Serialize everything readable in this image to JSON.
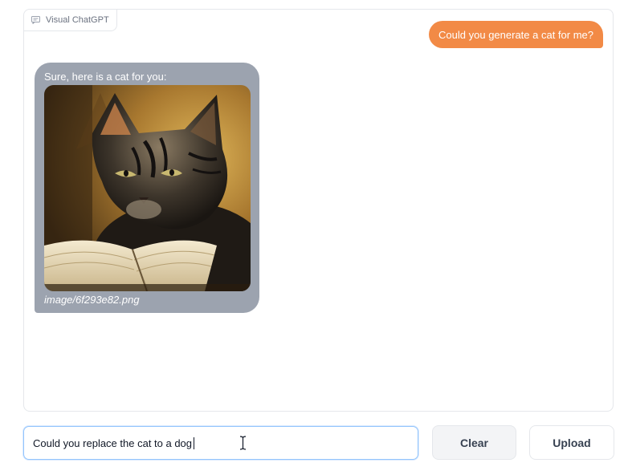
{
  "chatbot": {
    "label": "Visual ChatGPT",
    "label_icon": "chat-icon",
    "messages": [
      {
        "role": "user",
        "text": "Could you generate a cat for me?"
      },
      {
        "role": "bot",
        "text": "Sure, here is a cat for you:",
        "image_caption": "image/6f293e82.png"
      }
    ]
  },
  "input": {
    "value": "Could you replace the cat to a dog"
  },
  "buttons": {
    "clear_label": "Clear",
    "upload_label": "Upload"
  },
  "colors": {
    "user_bubble": "#f28a46",
    "bot_bubble": "#9ca3af",
    "input_focus": "#93c5fd"
  }
}
